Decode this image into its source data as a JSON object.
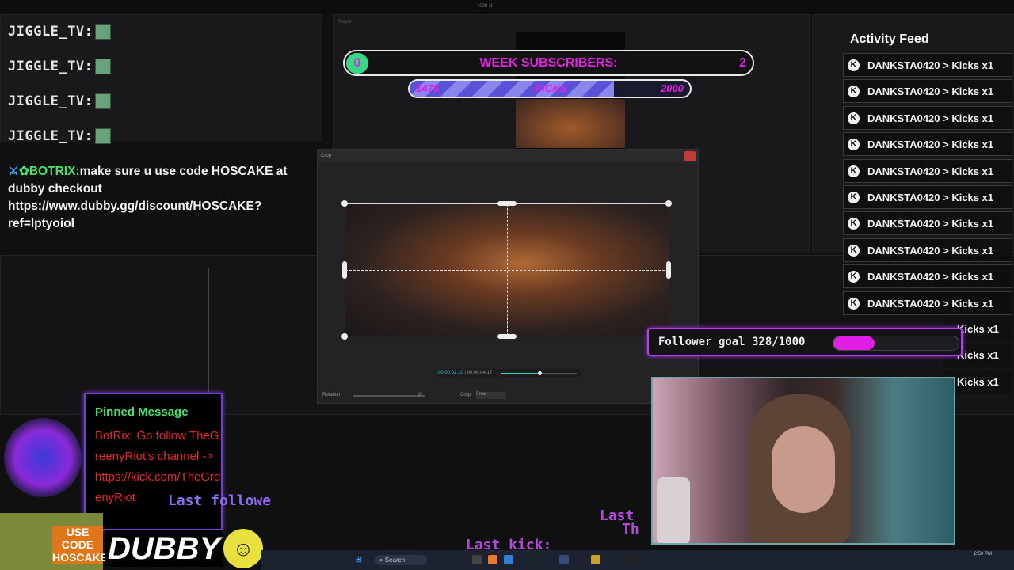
{
  "editor": {
    "top_title": "1009 (1)",
    "player_label": "Player",
    "dialog_title": "Crop",
    "time_current": "00:00:02:10",
    "time_total": "00:00:04:17",
    "rotation_label": "Rotation",
    "rotation_value": "0°",
    "crop_label": "Crop",
    "crop_value": "Free",
    "taskbar_search": "Search",
    "clock_time": "2:50 PM"
  },
  "chat": {
    "user": "JIGGLE_TV:",
    "bot_name": "BOTRIX:",
    "bot_message": "make sure u use code HOSCAKE at dubby checkout https://www.dubby.gg/discount/HOSCAKE?ref=lptyoiol"
  },
  "sub_goal": {
    "current": "0",
    "title": "WEEK SUBSCRIBERS:",
    "target": "2",
    "fill_fraction": 0.0
  },
  "kick_goal": {
    "start": "1475",
    "label": "KICKS",
    "end": "2000",
    "fill_fraction": 0.73
  },
  "activity_feed": {
    "title": "Activity Feed",
    "items": [
      "DANKSTA0420 > Kicks x1",
      "DANKSTA0420 > Kicks x1",
      "DANKSTA0420 > Kicks x1",
      "DANKSTA0420 > Kicks x1",
      "DANKSTA0420 > Kicks x1",
      "DANKSTA0420 > Kicks x1",
      "DANKSTA0420 > Kicks x1",
      "DANKSTA0420 > Kicks x1",
      "DANKSTA0420 > Kicks x1",
      "DANKSTA0420 > Kicks x1",
      "Kicks x1",
      "Kicks x1",
      "Kicks x1"
    ],
    "icon_letter": "K"
  },
  "follower_goal": {
    "text": "Follower goal 328/1000",
    "fill_fraction": 0.328
  },
  "pinned": {
    "title": "Pinned Message",
    "body": "BotRix: Go follow TheGreenyRiot's channel -> https://kick.com/TheGreenyRiot"
  },
  "overlay_text": {
    "last_follower": "Last followe",
    "last_kick": "Last kick:",
    "last_sub": "Last",
    "last_sub2": "Th"
  },
  "sponsor": {
    "use_code": "USE CODE HOSCAKE",
    "brand": "DUBBY"
  },
  "colors": {
    "accent_magenta": "#e61fe6",
    "accent_green": "#38d986",
    "pinned_green": "#46e06a",
    "pinned_red": "#e6262a",
    "frame_purple": "#7c3ad1"
  }
}
